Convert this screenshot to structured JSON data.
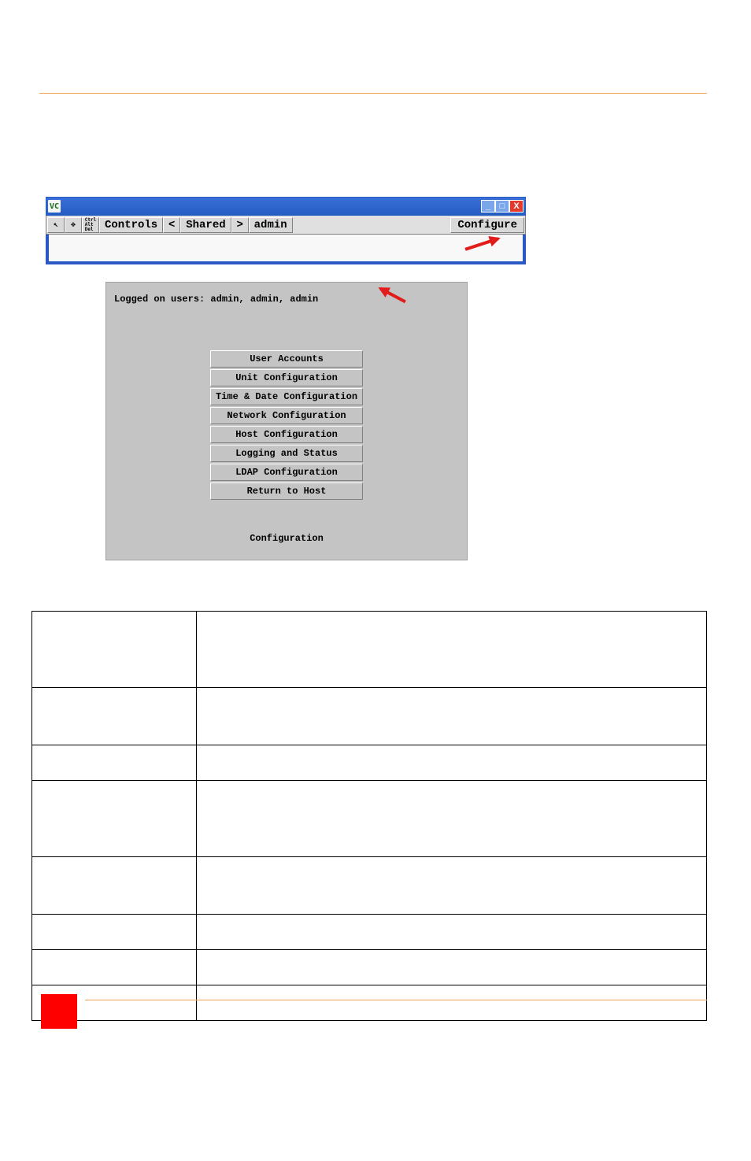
{
  "viewer": {
    "titlebar_app": "VC",
    "toolbar": {
      "controls_label": "Controls",
      "prev_label": "<",
      "mode_label": "Shared",
      "next_label": ">",
      "user_label": "admin",
      "configure_label": "Configure"
    }
  },
  "config_panel": {
    "logged_users_line": "Logged on users: admin, admin, admin",
    "caption": "Configuration",
    "menu": [
      "User Accounts",
      "Unit Configuration",
      "Time & Date Configuration",
      "Network Configuration",
      "Host Configuration",
      "Logging and Status",
      "LDAP Configuration",
      "Return to Host"
    ]
  },
  "table_rows": [
    {
      "label": "",
      "desc": ""
    },
    {
      "label": "",
      "desc": ""
    },
    {
      "label": "",
      "desc": ""
    },
    {
      "label": "",
      "desc": ""
    },
    {
      "label": "",
      "desc": ""
    },
    {
      "label": "",
      "desc": ""
    },
    {
      "label": "",
      "desc": ""
    },
    {
      "label": "",
      "desc": ""
    }
  ]
}
